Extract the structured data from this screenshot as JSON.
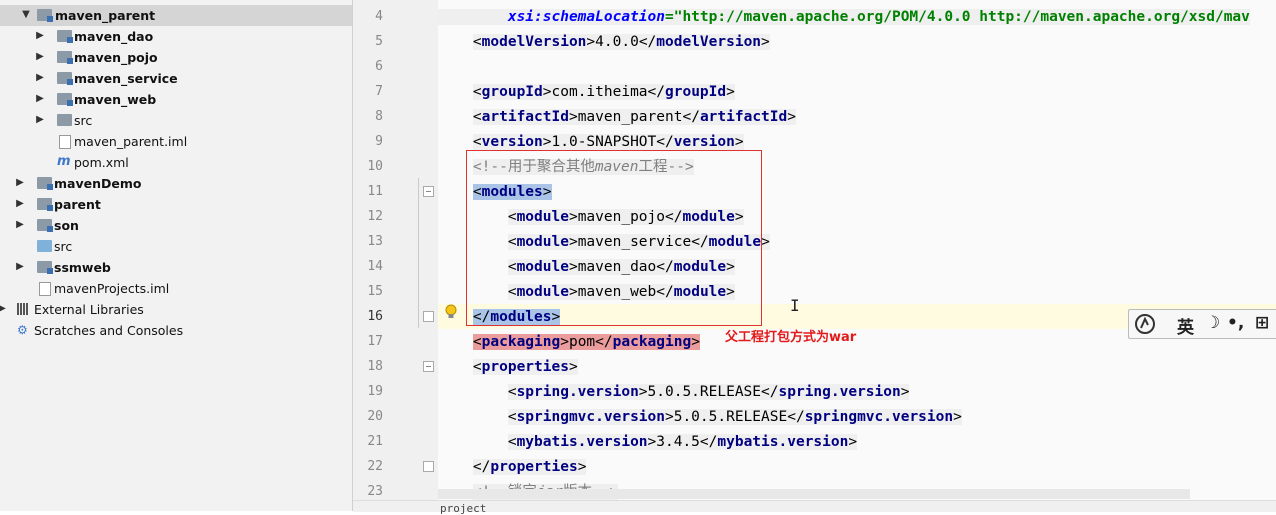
{
  "tree": {
    "items": [
      {
        "label": "maven_parent"
      },
      {
        "label": "maven_dao"
      },
      {
        "label": "maven_pojo"
      },
      {
        "label": "maven_service"
      },
      {
        "label": "maven_web"
      },
      {
        "label": "src"
      },
      {
        "label": "maven_parent.iml"
      },
      {
        "label": "pom.xml"
      },
      {
        "label": "mavenDemo"
      },
      {
        "label": "parent"
      },
      {
        "label": "son"
      },
      {
        "label": "src"
      },
      {
        "label": "ssmweb"
      },
      {
        "label": "mavenProjects.iml"
      },
      {
        "label": "External Libraries"
      },
      {
        "label": "Scratches and Consoles"
      }
    ]
  },
  "editor": {
    "line_numbers": [
      "4",
      "5",
      "6",
      "7",
      "8",
      "9",
      "10",
      "11",
      "12",
      "13",
      "14",
      "15",
      "16",
      "17",
      "18",
      "19",
      "20",
      "21",
      "22",
      "23"
    ],
    "l4": {
      "attr": "xsi:schemaLocation",
      "eq": "=",
      "value": "\"http://maven.apache.org/POM/4.0.0 http://maven.apache.org/xsd/mav"
    },
    "l5": {
      "tag": "modelVersion",
      "text": "4.0.0"
    },
    "l7": {
      "tag": "groupId",
      "text": "com.itheima"
    },
    "l8": {
      "tag": "artifactId",
      "text": "maven_parent"
    },
    "l9": {
      "tag": "version",
      "text": "1.0-SNAPSHOT"
    },
    "l10": {
      "open": "<!--",
      "text1": "用于聚合其他",
      "italic": "maven",
      "text2": "工程",
      "close": "-->"
    },
    "l11": {
      "tag": "modules"
    },
    "l12": {
      "tag": "module",
      "text": "maven_pojo"
    },
    "l13": {
      "tag": "module",
      "text": "maven_service"
    },
    "l14": {
      "tag": "module",
      "text": "maven_dao"
    },
    "l15": {
      "tag": "module",
      "text": "maven_web"
    },
    "l16": {
      "tag": "modules"
    },
    "l17": {
      "tag": "packaging",
      "text": "pom"
    },
    "l18": {
      "tag": "properties"
    },
    "l19": {
      "tag": "spring.version",
      "text": "5.0.5.RELEASE"
    },
    "l20": {
      "tag": "springmvc.version",
      "text": "5.0.5.RELEASE"
    },
    "l21": {
      "tag": "mybatis.version",
      "text": "3.4.5"
    },
    "l22": {
      "tag": "properties"
    },
    "l23": {
      "open": "<!--",
      "text1": "锁定",
      "italic": "jar",
      "text2": "版本",
      "close": "-->"
    },
    "breadcrumb": "project"
  },
  "annotation": "父工程打包方式为war",
  "ime": {
    "lang": "英",
    "moon": "☽",
    "punct": "•,",
    "extra": "⊞"
  }
}
